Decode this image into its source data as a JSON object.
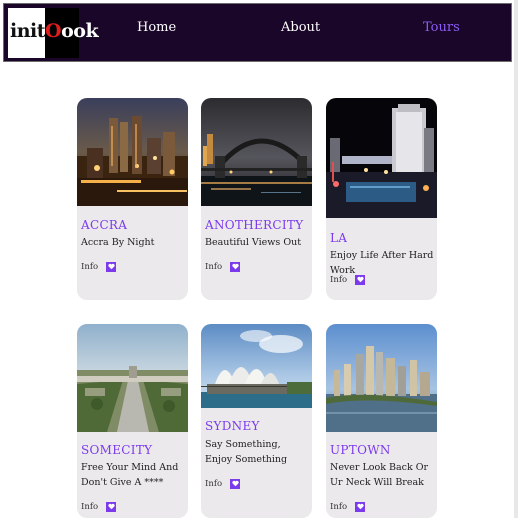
{
  "brand": {
    "logo_part_a": "init",
    "logo_part_b": "O",
    "logo_part_c": "ook",
    "accent_color": "#7c3aed",
    "nav_background": "#1a0628"
  },
  "nav": {
    "items": [
      {
        "label": "Home",
        "active": false
      },
      {
        "label": "About",
        "active": false
      },
      {
        "label": "Tours",
        "active": true
      }
    ]
  },
  "cards": [
    {
      "title": "ACCRA",
      "description": "Accra By Night",
      "info_label": "Info",
      "info_icon": "heart-icon",
      "image": "night-city-skyline"
    },
    {
      "title": "ANOTHERCITY",
      "description": "Beautiful Views Out",
      "info_label": "Info",
      "info_icon": "heart-icon",
      "image": "harbour-bridge-at-night"
    },
    {
      "title": "LA",
      "description": "Enjoy Life After Hard Work",
      "info_label": "Info",
      "info_icon": "heart-icon",
      "image": "illuminated-hotel-at-night"
    },
    {
      "title": "SOMECITY",
      "description": "Free Your Mind And Don't Give A ****",
      "info_label": "Info",
      "info_icon": "heart-icon",
      "image": "city-avenue-aerial"
    },
    {
      "title": "SYDNEY",
      "description": "Say Something, Enjoy Something",
      "info_label": "Info",
      "info_icon": "heart-icon",
      "image": "opera-house"
    },
    {
      "title": "UPTOWN",
      "description": "Never Look Back Or Ur Neck Will Break",
      "info_label": "Info",
      "info_icon": "heart-icon",
      "image": "river-skyline-daytime"
    }
  ]
}
